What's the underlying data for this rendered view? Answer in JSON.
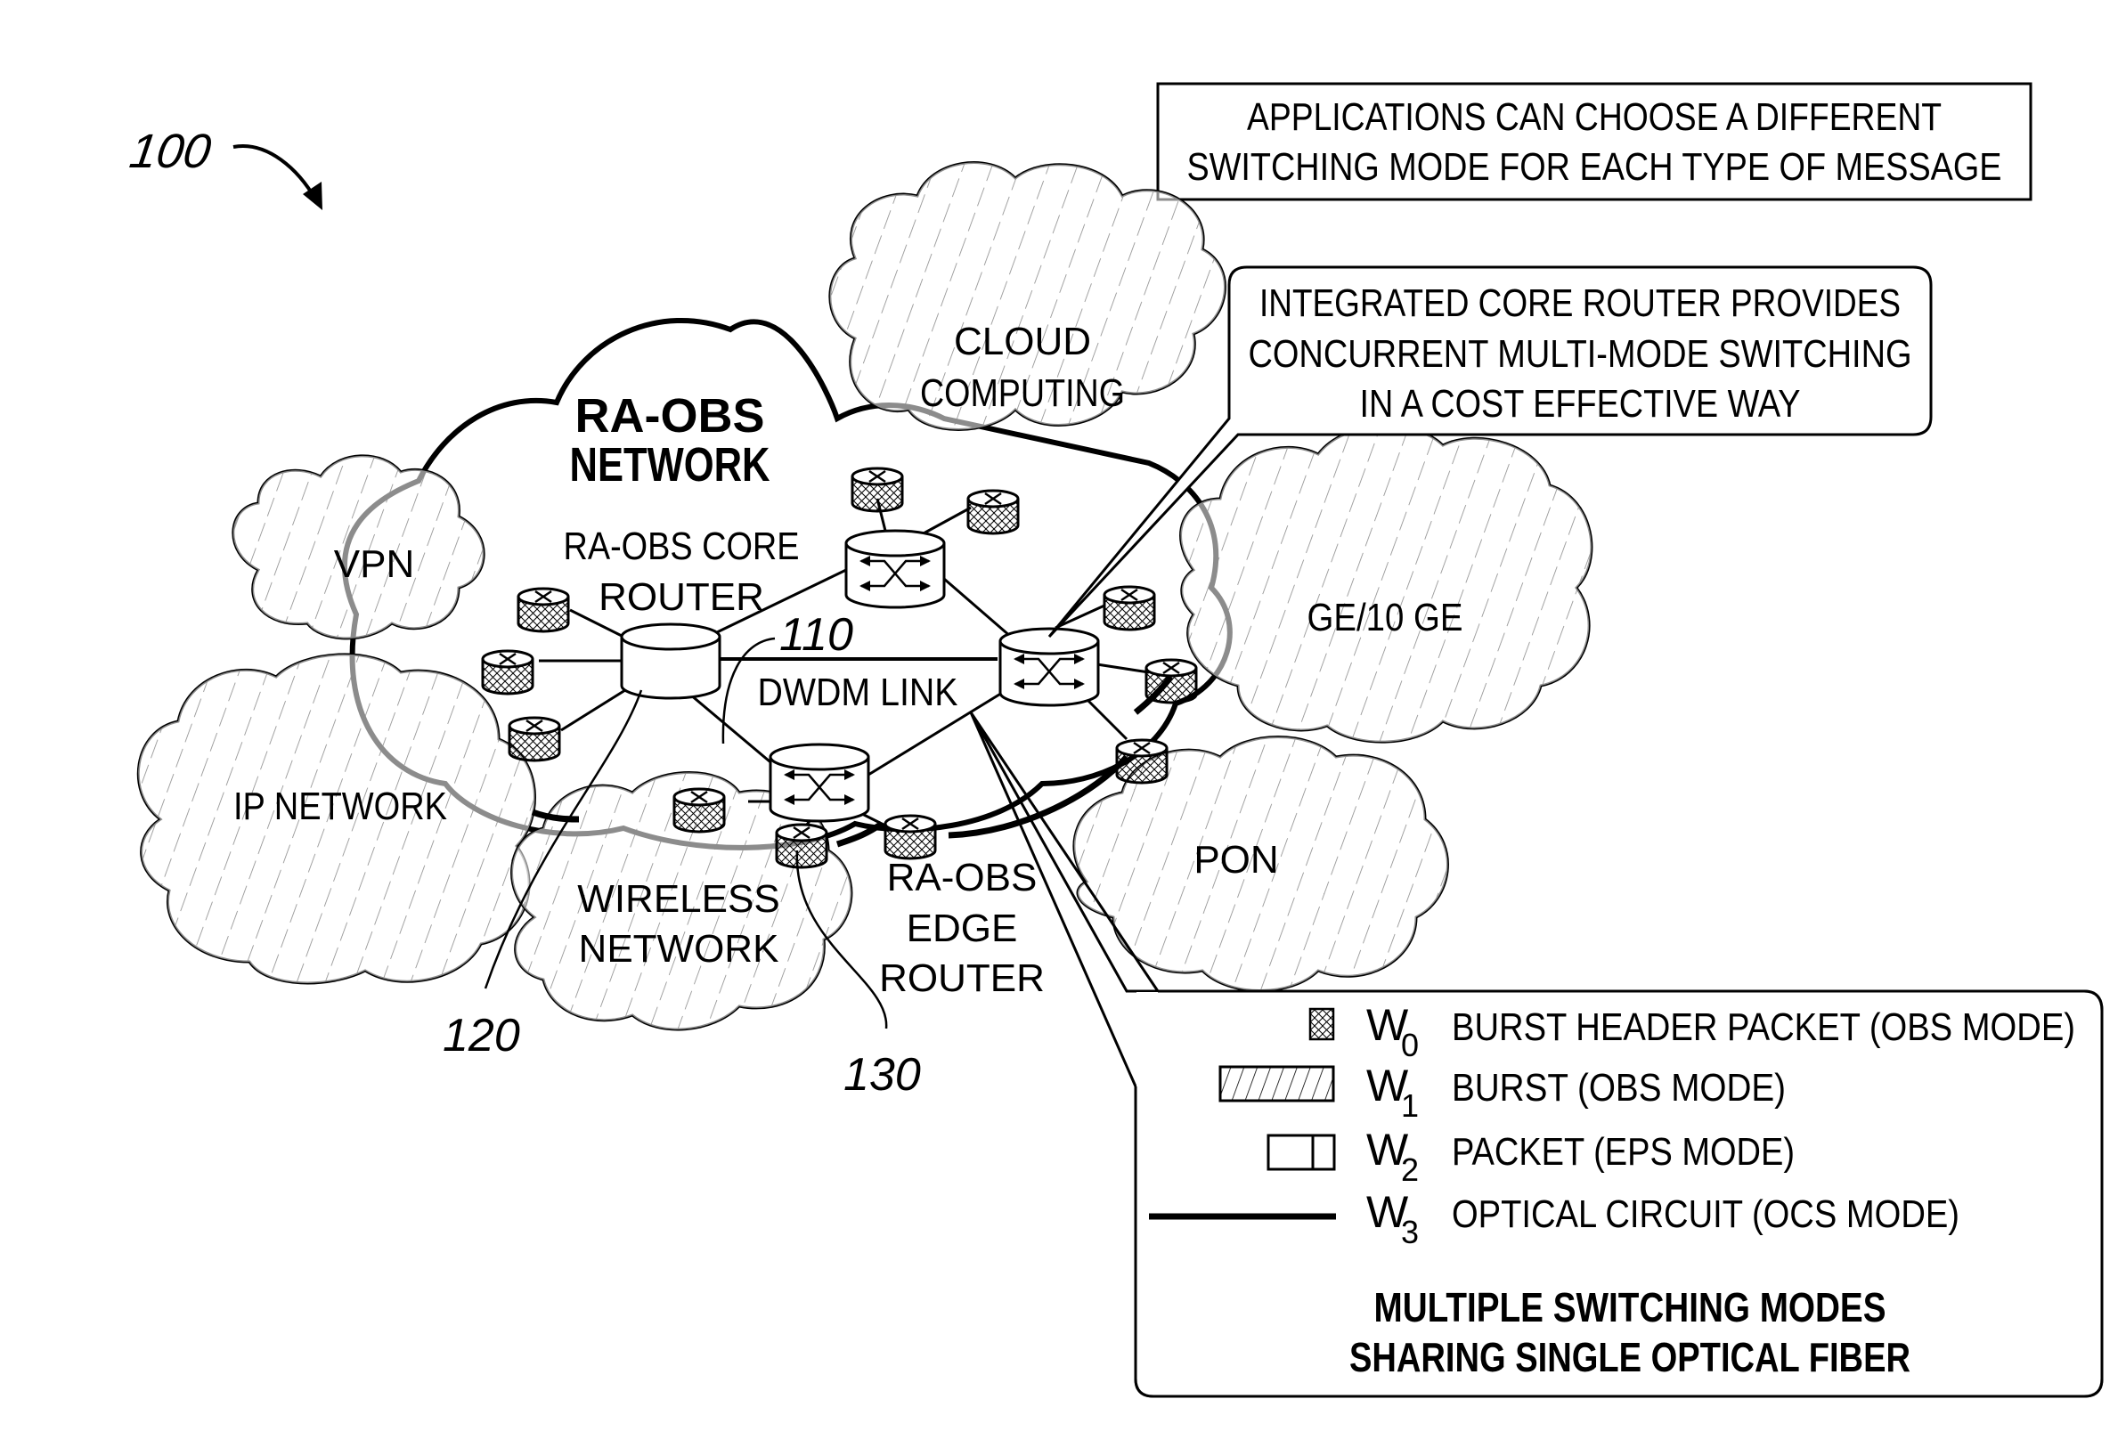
{
  "figure": {
    "reference_label": "100",
    "callout_labels": {
      "core_router_ref": "110",
      "ring_ref": "120",
      "edge_router_ref": "130"
    }
  },
  "top_note": {
    "line1": "APPLICATIONS CAN CHOOSE A DIFFERENT",
    "line2": "SWITCHING MODE FOR EACH TYPE OF MESSAGE"
  },
  "callout": {
    "line1": "INTEGRATED CORE ROUTER PROVIDES",
    "line2": "CONCURRENT MULTI-MODE SWITCHING",
    "line3": "IN A COST EFFECTIVE WAY"
  },
  "network": {
    "title_line1": "RA-OBS",
    "title_line2": "NETWORK",
    "core_router_line1": "RA-OBS CORE",
    "core_router_line2": "ROUTER",
    "link_label": "DWDM LINK",
    "edge_router_line1": "RA-OBS",
    "edge_router_line2": "EDGE",
    "edge_router_line3": "ROUTER"
  },
  "clouds": {
    "cloud_computing_line1": "CLOUD",
    "cloud_computing_line2": "COMPUTING",
    "vpn": "VPN",
    "ge": "GE/10 GE",
    "ip": "IP NETWORK",
    "wireless_line1": "WIRELESS",
    "wireless_line2": "NETWORK",
    "pon": "PON"
  },
  "legend": {
    "items": [
      {
        "symbol": "W",
        "sub": "0",
        "label": "BURST HEADER PACKET (OBS MODE)",
        "swatch": "crosshatch"
      },
      {
        "symbol": "W",
        "sub": "1",
        "label": "BURST (OBS MODE)",
        "swatch": "diagonal-hatch"
      },
      {
        "symbol": "W",
        "sub": "2",
        "label": "PACKET (EPS MODE)",
        "swatch": "split-box"
      },
      {
        "symbol": "W",
        "sub": "3",
        "label": "OPTICAL CIRCUIT (OCS MODE)",
        "swatch": "thick-line"
      }
    ],
    "footer_line1": "MULTIPLE SWITCHING MODES",
    "footer_line2": "SHARING SINGLE OPTICAL FIBER"
  },
  "colors": {
    "ink": "#000000",
    "paper": "#ffffff"
  }
}
